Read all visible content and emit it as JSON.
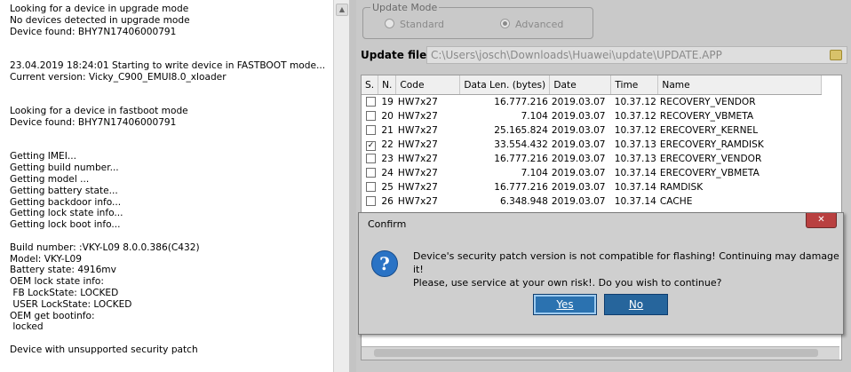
{
  "log": {
    "lines": [
      "Looking for a device in upgrade mode",
      "No devices detected in upgrade mode",
      "Device found: BHY7N17406000791",
      "",
      "",
      "23.04.2019 18:24:01 Starting to write device in FASTBOOT mode...",
      "Current version: Vicky_C900_EMUI8.0_xloader",
      "",
      "",
      "Looking for a device in fastboot mode",
      "Device found: BHY7N17406000791",
      "",
      "",
      "Getting IMEI...",
      "Getting build number...",
      "Getting model ...",
      "Getting battery state...",
      "Getting backdoor info...",
      "Getting lock state info...",
      "Getting lock boot info...",
      "",
      "Build number: :VKY-L09 8.0.0.386(C432)",
      "Model: VKY-L09",
      "Battery state: 4916mv",
      "OEM lock state info:",
      " FB LockState: LOCKED",
      " USER LockState: LOCKED",
      "OEM get bootinfo:",
      " locked",
      "",
      "Device with unsupported security patch"
    ]
  },
  "update_mode": {
    "legend": "Update Mode",
    "standard_label": "Standard",
    "advanced_label": "Advanced",
    "selected": "Advanced"
  },
  "update_file": {
    "label": "Update file:",
    "value": "C:\\Users\\josch\\Downloads\\Huawei\\update\\UPDATE.APP"
  },
  "table": {
    "columns": [
      "S.",
      "N.",
      "Code",
      "Data Len. (bytes)",
      "Date",
      "Time",
      "Name"
    ],
    "rows": [
      {
        "checked": false,
        "n": "19",
        "code": "HW7x27",
        "len": "16.777.216",
        "date": "2019.03.07",
        "time": "10.37.12",
        "name": "RECOVERY_VENDOR"
      },
      {
        "checked": false,
        "n": "20",
        "code": "HW7x27",
        "len": "7.104",
        "date": "2019.03.07",
        "time": "10.37.12",
        "name": "RECOVERY_VBMETA"
      },
      {
        "checked": false,
        "n": "21",
        "code": "HW7x27",
        "len": "25.165.824",
        "date": "2019.03.07",
        "time": "10.37.12",
        "name": "ERECOVERY_KERNEL"
      },
      {
        "checked": true,
        "n": "22",
        "code": "HW7x27",
        "len": "33.554.432",
        "date": "2019.03.07",
        "time": "10.37.13",
        "name": "ERECOVERY_RAMDISK"
      },
      {
        "checked": false,
        "n": "23",
        "code": "HW7x27",
        "len": "16.777.216",
        "date": "2019.03.07",
        "time": "10.37.13",
        "name": "ERECOVERY_VENDOR"
      },
      {
        "checked": false,
        "n": "24",
        "code": "HW7x27",
        "len": "7.104",
        "date": "2019.03.07",
        "time": "10.37.14",
        "name": "ERECOVERY_VBMETA"
      },
      {
        "checked": false,
        "n": "25",
        "code": "HW7x27",
        "len": "16.777.216",
        "date": "2019.03.07",
        "time": "10.37.14",
        "name": "RAMDISK"
      },
      {
        "checked": false,
        "n": "26",
        "code": "HW7x27",
        "len": "6.348.948",
        "date": "2019.03.07",
        "time": "10.37.14",
        "name": "CACHE"
      }
    ]
  },
  "dialog": {
    "title": "Confirm",
    "close_glyph": "✕",
    "icon_glyph": "?",
    "message_line1": "Device's security patch version is not compatible for flashing! Continuing may damage it!",
    "message_line2": "Please, use service at your own risk!. Do you wish to continue?",
    "yes_label": "Yes",
    "no_label": "No"
  },
  "colors": {
    "dialog_button": "#2b72b0",
    "close_button": "#b94040",
    "panel_bg": "#c9c9c9"
  }
}
